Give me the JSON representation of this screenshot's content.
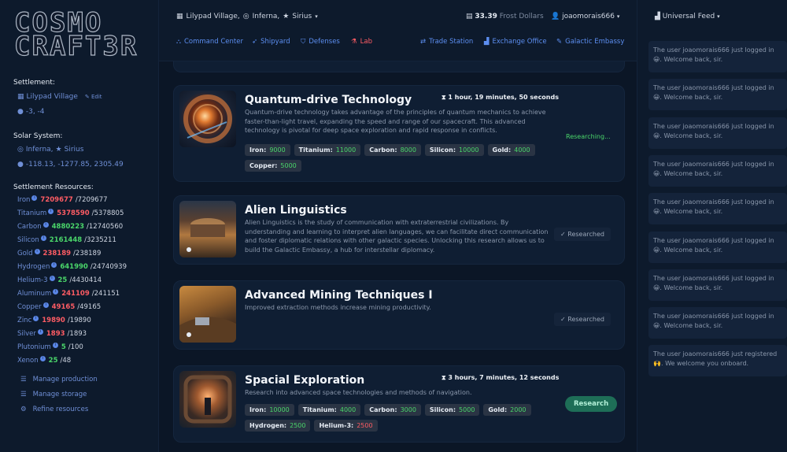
{
  "app": {
    "logo_line1": "COSMO",
    "logo_line2": "CRAFT3R"
  },
  "sidebar": {
    "settlement_title": "Settlement:",
    "settlement_name": "Lilypad Village",
    "edit_label": "Edit",
    "settlement_coords": "-3, -4",
    "solar_title": "Solar System:",
    "solar_galaxy": "Inferna,",
    "solar_star": "Sirius",
    "solar_coords": "-118.13, -1277.85, 2305.49",
    "resources_title": "Settlement Resources:",
    "resources": [
      {
        "name": "Iron",
        "current": "7209677",
        "max": "/7209677",
        "status": "red"
      },
      {
        "name": "Titanium",
        "current": "5378590",
        "max": "/5378805",
        "status": "red"
      },
      {
        "name": "Carbon",
        "current": "4880223",
        "max": "/12740560",
        "status": "green"
      },
      {
        "name": "Silicon",
        "current": "2161448",
        "max": "/3235211",
        "status": "green"
      },
      {
        "name": "Gold",
        "current": "238189",
        "max": "/238189",
        "status": "red"
      },
      {
        "name": "Hydrogen",
        "current": "641990",
        "max": "/24740939",
        "status": "green"
      },
      {
        "name": "Helium-3",
        "current": "25",
        "max": "/4430414",
        "status": "green"
      },
      {
        "name": "Aluminum",
        "current": "241109",
        "max": "/241151",
        "status": "red"
      },
      {
        "name": "Copper",
        "current": "49165",
        "max": "/49165",
        "status": "red"
      },
      {
        "name": "Zinc",
        "current": "19890",
        "max": "/19890",
        "status": "red"
      },
      {
        "name": "Silver",
        "current": "1893",
        "max": "/1893",
        "status": "red"
      },
      {
        "name": "Plutonium",
        "current": "5",
        "max": "/100",
        "status": "green"
      },
      {
        "name": "Xenon",
        "current": "25",
        "max": "/48",
        "status": "green"
      }
    ],
    "actions": [
      "Manage production",
      "Manage storage",
      "Refine resources"
    ]
  },
  "topbar": {
    "location_village": "Lilypad Village,",
    "location_galaxy": "Inferna,",
    "location_star": "Sirius",
    "money_amount": "33.39",
    "money_unit": "Frost Dollars",
    "username": "joaomorais666",
    "nav": [
      {
        "label": "Command Center",
        "icon": "rocket-base-icon"
      },
      {
        "label": "Shipyard",
        "icon": "rocket-icon"
      },
      {
        "label": "Defenses",
        "icon": "shield-icon"
      },
      {
        "label": "Lab",
        "icon": "flask-icon"
      },
      {
        "label": "Trade Station",
        "icon": "trade-icon"
      },
      {
        "label": "Exchange Office",
        "icon": "chart-icon"
      },
      {
        "label": "Galactic Embassy",
        "icon": "embassy-icon"
      }
    ]
  },
  "research": [
    {
      "title": "Quantum-drive Technology",
      "timer": "1 hour, 19 minutes, 50 seconds",
      "status": "Researching...",
      "description": "Quantum-drive technology takes advantage of the principles of quantum mechanics to achieve faster-than-light travel, expanding the speed and range of our spacecraft. This advanced technology is pivotal for deep space exploration and rapid response in conflicts.",
      "costs": [
        {
          "name": "Iron:",
          "value": "9000",
          "color": "green"
        },
        {
          "name": "Titanium:",
          "value": "11000",
          "color": "green"
        },
        {
          "name": "Carbon:",
          "value": "8000",
          "color": "green"
        },
        {
          "name": "Silicon:",
          "value": "10000",
          "color": "green"
        },
        {
          "name": "Gold:",
          "value": "4000",
          "color": "green"
        },
        {
          "name": "Copper:",
          "value": "5000",
          "color": "green"
        }
      ]
    },
    {
      "title": "Alien Linguistics",
      "status": "Researched",
      "description": "Alien Linguistics is the study of communication with extraterrestrial civilizations. By understanding and learning to interpret alien languages, we can facilitate direct communication and foster diplomatic relations with other galactic species. Unlocking this research allows us to build the Galactic Embassy, a hub for interstellar diplomacy."
    },
    {
      "title": "Advanced Mining Techniques I",
      "status": "Researched",
      "description": "Improved extraction methods increase mining productivity."
    },
    {
      "title": "Spacial Exploration",
      "timer": "3 hours, 7 minutes, 12 seconds",
      "button": "Research",
      "description": "Research into advanced space technologies and methods of navigation.",
      "costs": [
        {
          "name": "Iron:",
          "value": "10000",
          "color": "green"
        },
        {
          "name": "Titanium:",
          "value": "4000",
          "color": "green"
        },
        {
          "name": "Carbon:",
          "value": "3000",
          "color": "green"
        },
        {
          "name": "Silicon:",
          "value": "5000",
          "color": "green"
        },
        {
          "name": "Gold:",
          "value": "2000",
          "color": "green"
        },
        {
          "name": "Hydrogen:",
          "value": "2500",
          "color": "green"
        },
        {
          "name": "Helium-3:",
          "value": "2500",
          "color": "red"
        }
      ]
    }
  ],
  "feed": {
    "title": "Universal Feed",
    "items": [
      {
        "a": "The user joaomorais666 just logged in",
        "b": "Welcome back, sir."
      },
      {
        "a": "The user joaomorais666 just logged in",
        "b": "Welcome back, sir."
      },
      {
        "a": "The user joaomorais666 just logged in",
        "b": "Welcome back, sir."
      },
      {
        "a": "The user joaomorais666 just logged in",
        "b": "Welcome back, sir."
      },
      {
        "a": "The user joaomorais666 just logged in",
        "b": "Welcome back, sir."
      },
      {
        "a": "The user joaomorais666 just logged in",
        "b": "Welcome back, sir."
      },
      {
        "a": "The user joaomorais666 just logged in",
        "b": "Welcome back, sir."
      },
      {
        "a": "The user joaomorais666 just logged in",
        "b": "Welcome back, sir."
      },
      {
        "a": "The user joaomorais666 just registered",
        "b": "We welcome you onboard."
      }
    ]
  },
  "colors": {
    "accent": "#5c8ef0",
    "danger": "#ff5c64",
    "success": "#4ad66a",
    "panel": "#0f1e33"
  }
}
